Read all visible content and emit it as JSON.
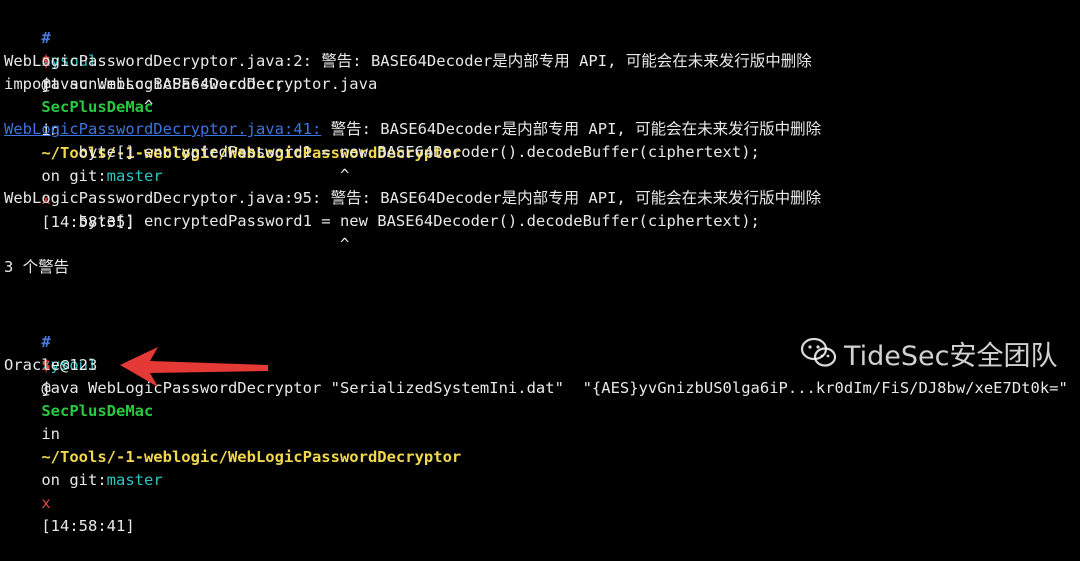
{
  "colors": {
    "background": "#000000",
    "hash_prompt": "#4a7bd8",
    "user": "#2ec4c4",
    "host": "#27c93f",
    "path": "#f1d84b",
    "branch": "#2ec4c4",
    "dirty_mark": "#e0463c",
    "link": "#3b74e0",
    "arrow": "#e53935"
  },
  "prompt1": {
    "hash": "#",
    "user": "xysoul",
    "at": "@",
    "host": "SecPlusDeMac",
    "in": "in",
    "path": "~/Tools/-1-weblogic/WebLogicPasswordDecryptor",
    "on": "on",
    "git": "git:",
    "branch": "master",
    "dirty": "x",
    "time": "[14:58:35]"
  },
  "cmd1": {
    "dollar": "$",
    "text": "javac WebLogicPasswordDecryptor.java"
  },
  "out": {
    "l1": "WebLogicPasswordDecryptor.java:2: 警告: BASE64Decoder是内部专用 API, 可能会在未来发行版中删除",
    "l2": "import sun.misc.BASE64Decoder;",
    "l3": "               ^",
    "l4_link": "WebLogicPasswordDecryptor.java:41:",
    "l4_rest": " 警告: BASE64Decoder是内部专用 API, 可能会在未来发行版中删除",
    "l5": "        byte[] encryptedPassword1 = new BASE64Decoder().decodeBuffer(ciphertext);",
    "l6": "                                    ^",
    "l7": "WebLogicPasswordDecryptor.java:95: 警告: BASE64Decoder是内部专用 API, 可能会在未来发行版中删除",
    "l8": "        byte[] encryptedPassword1 = new BASE64Decoder().decodeBuffer(ciphertext);",
    "l9": "                                    ^",
    "l10": "3 个警告"
  },
  "prompt2": {
    "hash": "#",
    "user": "xysoul",
    "at": "@",
    "host": "SecPlusDeMac",
    "in": "in",
    "path": "~/Tools/-1-weblogic/WebLogicPasswordDecryptor",
    "on": "on",
    "git": "git:",
    "branch": "master",
    "dirty": "x",
    "time": "[14:58:41]"
  },
  "cmd2": {
    "dollar": "$",
    "text": "java WebLogicPasswordDecryptor \"SerializedSystemIni.dat\"  \"{AES}yvGnizbUS0lga6iP...kr0dIm/FiS/DJ8bw/xeE7Dt0k=\""
  },
  "result": "Oracle@123",
  "watermark": {
    "text": "TideSec安全团队",
    "icon": "wechat-icon"
  },
  "arrow": {
    "icon": "red-arrow-left-icon"
  }
}
